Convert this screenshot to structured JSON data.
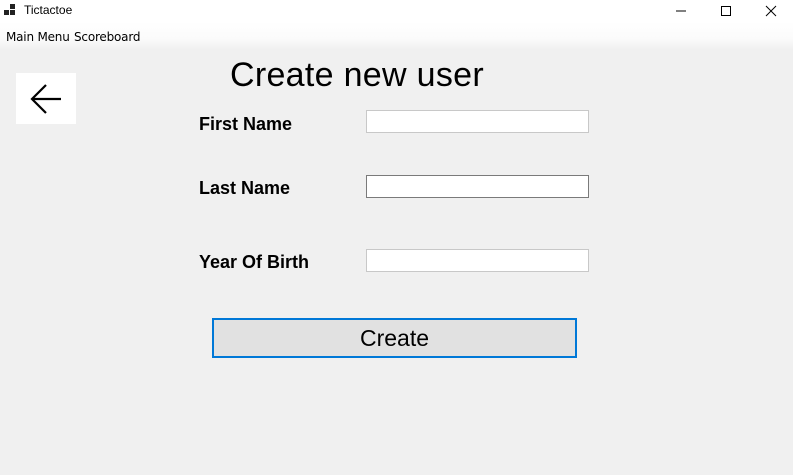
{
  "window": {
    "title": "Tictactoe",
    "controls": {
      "minimize": "—",
      "maximize": "☐",
      "close": "✕"
    }
  },
  "menu": {
    "items": [
      "Main Menu",
      "Scoreboard"
    ]
  },
  "back": {
    "icon": "arrow-left-icon"
  },
  "page": {
    "title": "Create new user"
  },
  "form": {
    "first_name": {
      "label": "First Name",
      "value": ""
    },
    "last_name": {
      "label": "Last Name",
      "value": ""
    },
    "year_of_birth": {
      "label": "Year Of Birth",
      "value": ""
    },
    "submit_label": "Create"
  },
  "colors": {
    "background": "#f0f0f0",
    "focus_border": "#0078d7",
    "button_face": "#e1e1e1"
  }
}
